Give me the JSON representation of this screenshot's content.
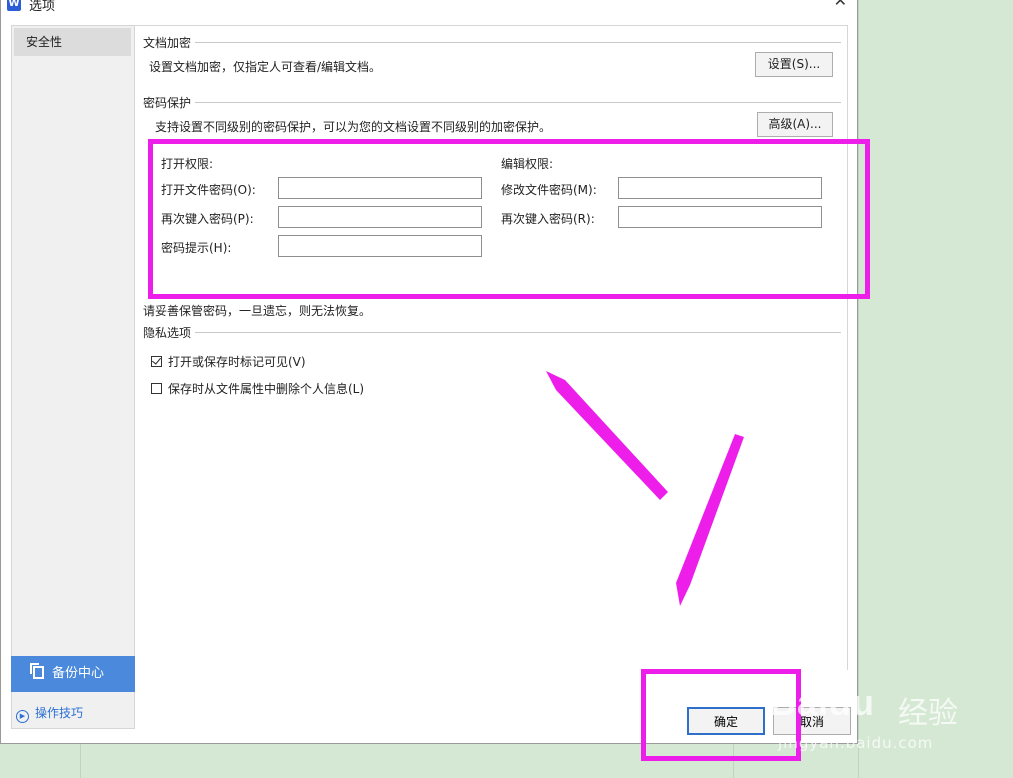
{
  "window": {
    "title": "选项",
    "app_icon": "W"
  },
  "sidebar": {
    "items": [
      {
        "label": "安全性",
        "selected": true
      }
    ],
    "backup_label": "备份中心",
    "tips_label": "操作技巧"
  },
  "encryption": {
    "heading": "文档加密",
    "description": "设置文档加密，仅指定人可查看/编辑文档。",
    "settings_button": "设置(S)..."
  },
  "password_protection": {
    "heading": "密码保护",
    "description": "支持设置不同级别的密码保护，可以为您的文档设置不同级别的加密保护。",
    "advanced_button": "高级(A)...",
    "open_permission": {
      "heading": "打开权限:",
      "open_password_label": "打开文件密码(O):",
      "open_password_value": "",
      "reenter_label": "再次键入密码(P):",
      "reenter_value": "",
      "hint_label": "密码提示(H):",
      "hint_value": ""
    },
    "edit_permission": {
      "heading": "编辑权限:",
      "modify_password_label": "修改文件密码(M):",
      "modify_password_value": "",
      "reenter_label": "再次键入密码(R):",
      "reenter_value": ""
    },
    "warning": "请妥善保管密码，一旦遗忘，则无法恢复。"
  },
  "privacy": {
    "heading": "隐私选项",
    "options": [
      {
        "label": "打开或保存时标记可见(V)",
        "checked": true
      },
      {
        "label": "保存时从文件属性中删除个人信息(L)",
        "checked": false
      }
    ]
  },
  "footer": {
    "ok_label": "确定",
    "cancel_label": "取消"
  },
  "watermark": {
    "brand": "Baidu",
    "cn": "经验",
    "url": "jingyan.baidu.com"
  },
  "annotation": {
    "color": "#ee1eea"
  }
}
